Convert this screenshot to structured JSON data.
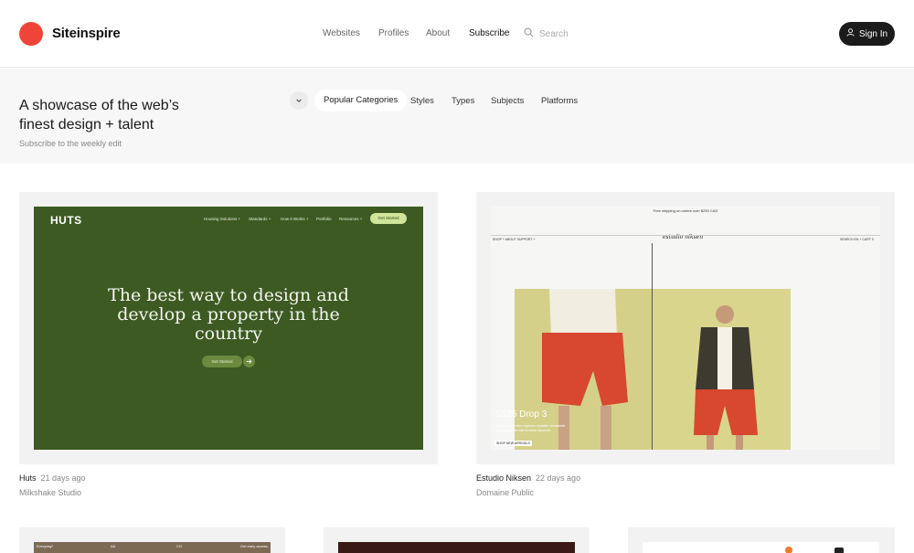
{
  "header": {
    "brand": "Siteinspire",
    "nav": [
      "Websites",
      "Profiles",
      "About",
      "Subscribe"
    ],
    "search_placeholder": "Search",
    "signin_label": "Sign In",
    "brand_color": "#f04438"
  },
  "hero": {
    "title": "A showcase of the web’s finest design + talent",
    "subtitle": "Subscribe to the weekly edit",
    "categories_active": "Popular Categories",
    "categories": [
      "Styles",
      "Types",
      "Subjects",
      "Platforms"
    ]
  },
  "cards": [
    {
      "name": "Huts",
      "ago": "21 days ago",
      "studio": "Milkshake Studio",
      "preview": {
        "logo": "HUTS",
        "nav": [
          "Housing Solutions +",
          "Standards +",
          "How It Works +",
          "Portfolio",
          "Resources +"
        ],
        "nav_cta": "Get Started",
        "headline": "The best way to design and develop a property in the country",
        "button": "Get Started",
        "bg_color": "#3c5a22"
      }
    },
    {
      "name": "Estudio Niksen",
      "ago": "22 days ago",
      "studio": "Domaine Public",
      "preview": {
        "shipping": "Free shipping on orders over $250 CAD",
        "nav_left": "SHOP +   ABOUT   SUPPORT +",
        "logo": "estudio niksen",
        "nav_right": "SEARCH   EN +   CART   0",
        "drop": "SS25 Drop 3",
        "description": "Our latest collection explores versatile, breathable everyday pieces with timeless structure.",
        "shop_cta": "SHOP NEW ARRIVALS"
      }
    }
  ],
  "bottom_peeks": {
    "first": {
      "left": "Everyday*",
      "mid1": "AA",
      "mid2": "CO",
      "right": "Get early access"
    }
  }
}
